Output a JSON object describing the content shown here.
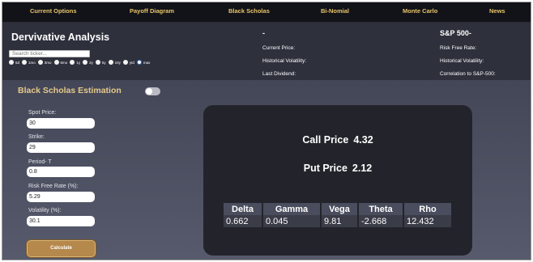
{
  "nav": {
    "items": [
      "Current Options",
      "Payoff Diagram",
      "Black Scholas",
      "Bi-Nomial",
      "Monte Carlo",
      "News"
    ]
  },
  "header": {
    "brand": "Dervivative Analysis",
    "search_placeholder": "Search ticker...",
    "ranges": [
      "5d",
      "1mo",
      "3mo",
      "6mo",
      "1y",
      "2y",
      "5y",
      "10y",
      "ytd",
      "max"
    ],
    "selected_range": "max",
    "ticker": "-",
    "current_price_label": "Current Price:",
    "hist_vol_label": "Historical Volatility:",
    "last_dividend_label": "Last Dividend:",
    "index_title": "S&P 500-",
    "risk_free_label": "Risk Free Rate:",
    "index_hist_vol_label": "Historical Volatility:",
    "correlation_label": "Correlation to S&P-500:"
  },
  "estimation": {
    "title": "Black Scholas Estimation",
    "toggle_on": false,
    "fields": {
      "spot": {
        "label": "Spot Price:",
        "value": "30"
      },
      "strike": {
        "label": "Strike:",
        "value": "29"
      },
      "period": {
        "label": "Period- T",
        "value": "0.8"
      },
      "rate": {
        "label": "Risk Free Rate (%):",
        "value": "5.29"
      },
      "vol": {
        "label": "Volatility (%):",
        "value": "30.1"
      }
    },
    "calculate_label": "Calculate"
  },
  "results": {
    "call_label": "Call Price",
    "call_value": "4.32",
    "put_label": "Put Price",
    "put_value": "2.12",
    "greek_headers": [
      "Delta",
      "Gamma",
      "Vega",
      "Theta",
      "Rho"
    ],
    "greek_values": [
      "0.662",
      "0.045",
      "9.81",
      "-2.668",
      "12.432"
    ]
  },
  "colors": {
    "nav_text": "#e8c56a",
    "section_title": "#e6c98c",
    "button": "#b5884b",
    "card": "#23242b"
  }
}
